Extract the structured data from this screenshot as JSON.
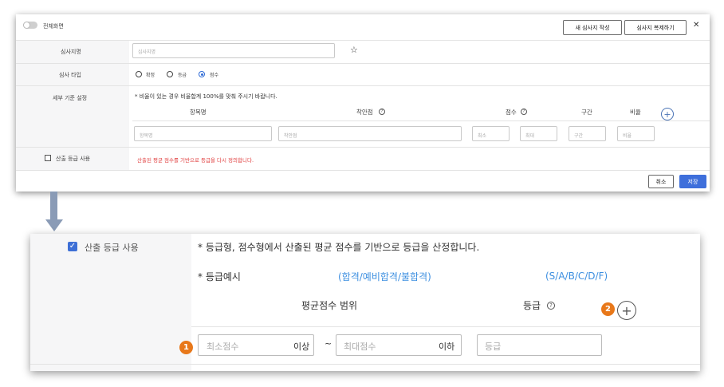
{
  "top": {
    "fullscreen_label": "전체화면",
    "new_sheet_button": "새 심사지 작성",
    "copy_sheet_button": "심사지 복제하기",
    "close_glyph": "✕",
    "name_label": "심사지명",
    "name_placeholder": "심사지명",
    "type_label": "심사 타입",
    "type_options": [
      "확정",
      "등급",
      "점수"
    ],
    "detail_label": "세부 기준 설정",
    "notice": "* 비율이 있는 경우 비율합계 100%를 맞춰 주시기 바랍니다.",
    "columns": {
      "item": "항목명",
      "points": "착안점",
      "score": "점수",
      "range": "구간",
      "ratio": "비율"
    },
    "placeholders": {
      "item": "항목명",
      "points": "착안점",
      "min": "최소",
      "max": "최대",
      "range": "구간",
      "ratio": "비율"
    },
    "grade_checkbox_label": "산출 등급 사용",
    "grade_warning": "산출된 평균 점수를 기반으로 등급을 다시 정의합니다.",
    "cancel_button": "취소",
    "save_button": "저장"
  },
  "bottom": {
    "grade_checkbox_label": "산출 등급 사용",
    "notice": "* 등급형, 점수형에서 산출된 평균 점수를 기반으로 등급을 산정합니다.",
    "example_label": "* 등급예시",
    "example_pass": "(합격/예비합격/불합격)",
    "example_grade": "(S/A/B/C/D/F)",
    "range_header": "평균점수 범위",
    "grade_header": "등급",
    "min_placeholder": "최소점수",
    "min_suffix": "이상",
    "tilde": "~",
    "max_placeholder": "최대점수",
    "max_suffix": "이하",
    "grade_placeholder": "등급",
    "badge1": "1",
    "badge2": "2"
  },
  "colors": {
    "accent": "#2f6bd6",
    "warning": "#e03c3c",
    "link": "#3d8fe0",
    "badge": "#e8781a",
    "save": "#3e6fdb"
  }
}
